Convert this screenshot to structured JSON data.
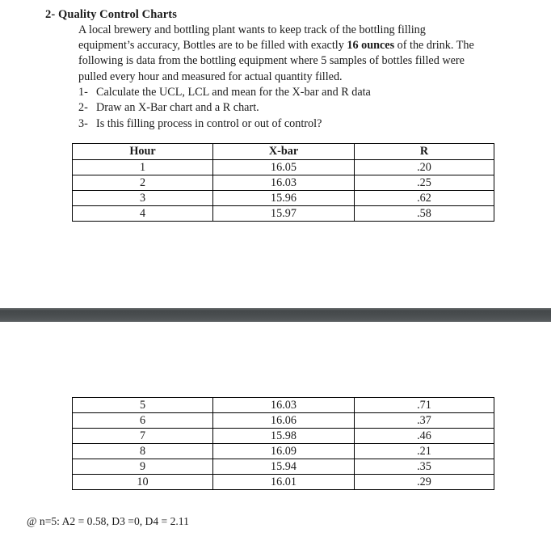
{
  "document": {
    "title": "2- Quality Control Charts",
    "intro_before_bold": "A local brewery and bottling plant wants to keep track of the bottling filling equipment’s accuracy, Bottles are to be filled with exactly ",
    "intro_bold": "16 ounces",
    "intro_after_bold": " of the drink. The following is data from the bottling equipment where 5 samples of bottles filled were pulled every hour and measured for actual quantity filled.",
    "questions": [
      {
        "number": "1-",
        "text": "Calculate the UCL, LCL and mean for the X-bar and R data"
      },
      {
        "number": "2-",
        "text": "Draw an X-Bar chart and a R chart."
      },
      {
        "number": "3-",
        "text": "Is this filling process in control or out of control?"
      }
    ],
    "footnote": "@ n=5: A2 = 0.58, D3 =0, D4 = 2.11"
  },
  "table_top": {
    "headers": [
      "Hour",
      "X-bar",
      "R"
    ],
    "rows": [
      [
        "1",
        "16.05",
        ".20"
      ],
      [
        "2",
        "16.03",
        ".25"
      ],
      [
        "3",
        "15.96",
        ".62"
      ],
      [
        "4",
        "15.97",
        ".58"
      ]
    ]
  },
  "table_bottom": {
    "rows": [
      [
        "5",
        "16.03",
        ".71"
      ],
      [
        "6",
        "16.06",
        ".37"
      ],
      [
        "7",
        "15.98",
        ".46"
      ],
      [
        "8",
        "16.09",
        ".21"
      ],
      [
        "9",
        "15.94",
        ".35"
      ],
      [
        "10",
        "16.01",
        ".29"
      ]
    ]
  }
}
